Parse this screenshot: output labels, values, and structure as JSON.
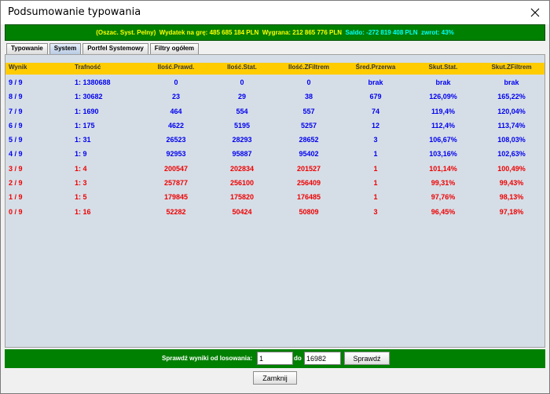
{
  "window": {
    "title": "Podsumowanie typowania"
  },
  "summary": {
    "mode": "(Oszac. Syst. Pelny)",
    "expense_label": "Wydatek na grę:",
    "expense_value": "485 685 184 PLN",
    "win_label": "Wygrana:",
    "win_value": "212 865 776 PLN",
    "balance_label": "Saldo:",
    "balance_value": "-272 819 408 PLN",
    "return_label": "zwrot:",
    "return_value": "43%"
  },
  "tabs": [
    {
      "label": "Typowanie",
      "active": false
    },
    {
      "label": "System",
      "active": true
    },
    {
      "label": "Portfel Systemowy",
      "active": false
    },
    {
      "label": "Filtry ogółem",
      "active": false
    }
  ],
  "table": {
    "columns": [
      "Wynik",
      "Trafność",
      "Ilość.Prawd.",
      "Ilość.Stat.",
      "Ilość.ZFiltrem",
      "Śred.Przerwa",
      "Skut.Stat.",
      "Skut.ZFiltrem"
    ],
    "rows": [
      {
        "color": "blue",
        "cells": [
          "9 / 9",
          "1: 1380688",
          "0",
          "0",
          "0",
          "brak",
          "brak",
          "brak"
        ]
      },
      {
        "color": "blue",
        "cells": [
          "8 / 9",
          "1: 30682",
          "23",
          "29",
          "38",
          "679",
          "126,09%",
          "165,22%"
        ]
      },
      {
        "color": "blue",
        "cells": [
          "7 / 9",
          "1: 1690",
          "464",
          "554",
          "557",
          "74",
          "119,4%",
          "120,04%"
        ]
      },
      {
        "color": "blue",
        "cells": [
          "6 / 9",
          "1: 175",
          "4622",
          "5195",
          "5257",
          "12",
          "112,4%",
          "113,74%"
        ]
      },
      {
        "color": "blue",
        "cells": [
          "5 / 9",
          "1: 31",
          "26523",
          "28293",
          "28652",
          "3",
          "106,67%",
          "108,03%"
        ]
      },
      {
        "color": "blue",
        "cells": [
          "4 / 9",
          "1: 9",
          "92953",
          "95887",
          "95402",
          "1",
          "103,16%",
          "102,63%"
        ]
      },
      {
        "color": "red",
        "cells": [
          "3 / 9",
          "1: 4",
          "200547",
          "202834",
          "201527",
          "1",
          "101,14%",
          "100,49%"
        ]
      },
      {
        "color": "red",
        "cells": [
          "2 / 9",
          "1: 3",
          "257877",
          "256100",
          "256409",
          "1",
          "99,31%",
          "99,43%"
        ]
      },
      {
        "color": "red",
        "cells": [
          "1 / 9",
          "1: 5",
          "179845",
          "175820",
          "176485",
          "1",
          "97,76%",
          "98,13%"
        ]
      },
      {
        "color": "red",
        "cells": [
          "0 / 9",
          "1: 16",
          "52282",
          "50424",
          "50809",
          "3",
          "96,45%",
          "97,18%"
        ]
      }
    ]
  },
  "check": {
    "label": "Sprawdź wyniki od losowania:",
    "from_value": "1",
    "to_label": "do",
    "to_value": "16982",
    "button_label": "Sprawdź"
  },
  "close_button_label": "Zamknij",
  "colors": {
    "bar_green": "#008000",
    "header_yellow": "#ffcc00",
    "panel_bg": "#d5dee7",
    "row_blue": "#0000ee",
    "row_red": "#ee0000"
  }
}
